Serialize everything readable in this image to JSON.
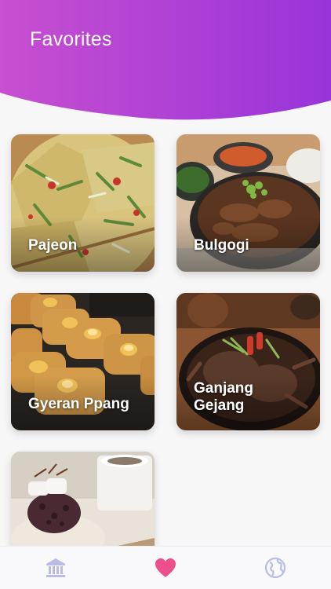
{
  "header": {
    "title": "Favorites",
    "gradient_start": "#c44fd1",
    "gradient_end": "#9a35d8"
  },
  "favorites": [
    {
      "name": "Pajeon"
    },
    {
      "name": "Bulgogi"
    },
    {
      "name": "Gyeran Ppang"
    },
    {
      "name": "Ganjang Gejang"
    },
    {
      "name": ""
    }
  ],
  "tabbar": {
    "tabs": [
      {
        "icon": "museum-icon",
        "active": false
      },
      {
        "icon": "heart-icon",
        "active": true
      },
      {
        "icon": "globe-icon",
        "active": false
      }
    ],
    "active_color": "#ec4f8c",
    "inactive_color": "#b9bde6"
  }
}
